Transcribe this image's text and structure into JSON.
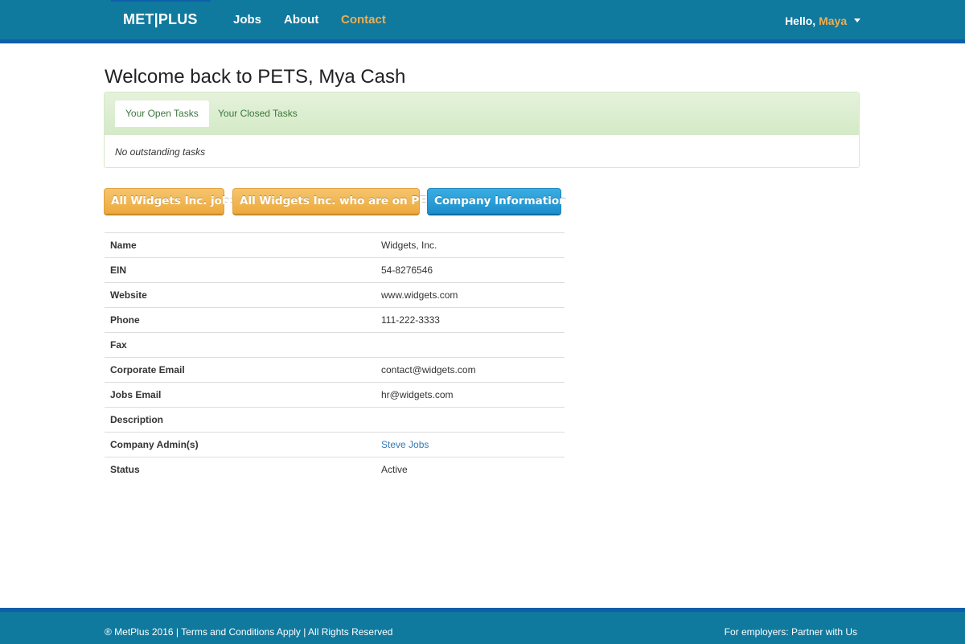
{
  "navbar": {
    "brand": "MET|PLUS",
    "links": [
      {
        "label": "Jobs"
      },
      {
        "label": "About"
      },
      {
        "label": "Contact"
      }
    ],
    "greeting": "Hello,",
    "user_name": "Maya",
    "colors": {
      "bar": "#10799e",
      "accent": "#f0ad4e"
    }
  },
  "main": {
    "title": "Welcome back to PETS, Mya Cash",
    "tasks": {
      "tabs": [
        {
          "label": "Your Open Tasks",
          "active": true
        },
        {
          "label": "Your Closed Tasks",
          "active": false
        }
      ],
      "empty_message": "No outstanding tasks"
    },
    "buttons": {
      "jobs": "All Widgets Inc. jobs",
      "people": "All Widgets Inc. who are on PETS",
      "company_info": "Company Information"
    },
    "company": {
      "rows": [
        {
          "label": "Name",
          "value": "Widgets, Inc."
        },
        {
          "label": "EIN",
          "value": "54-8276546"
        },
        {
          "label": "Website",
          "value": "www.widgets.com"
        },
        {
          "label": "Phone",
          "value": "111-222-3333"
        },
        {
          "label": "Fax",
          "value": ""
        },
        {
          "label": "Corporate Email",
          "value": "contact@widgets.com"
        },
        {
          "label": "Jobs Email",
          "value": "hr@widgets.com"
        },
        {
          "label": "Description",
          "value": ""
        },
        {
          "label": "Company Admin(s)",
          "value": "Steve Jobs"
        },
        {
          "label": "Status",
          "value": "Active"
        }
      ]
    }
  },
  "footer": {
    "copyright": "® MetPlus 2016",
    "sep1": "|",
    "terms": "Terms and Conditions Apply",
    "sep2": "|",
    "rights": "All Rights Reserved",
    "partner": "For employers: Partner with Us"
  }
}
